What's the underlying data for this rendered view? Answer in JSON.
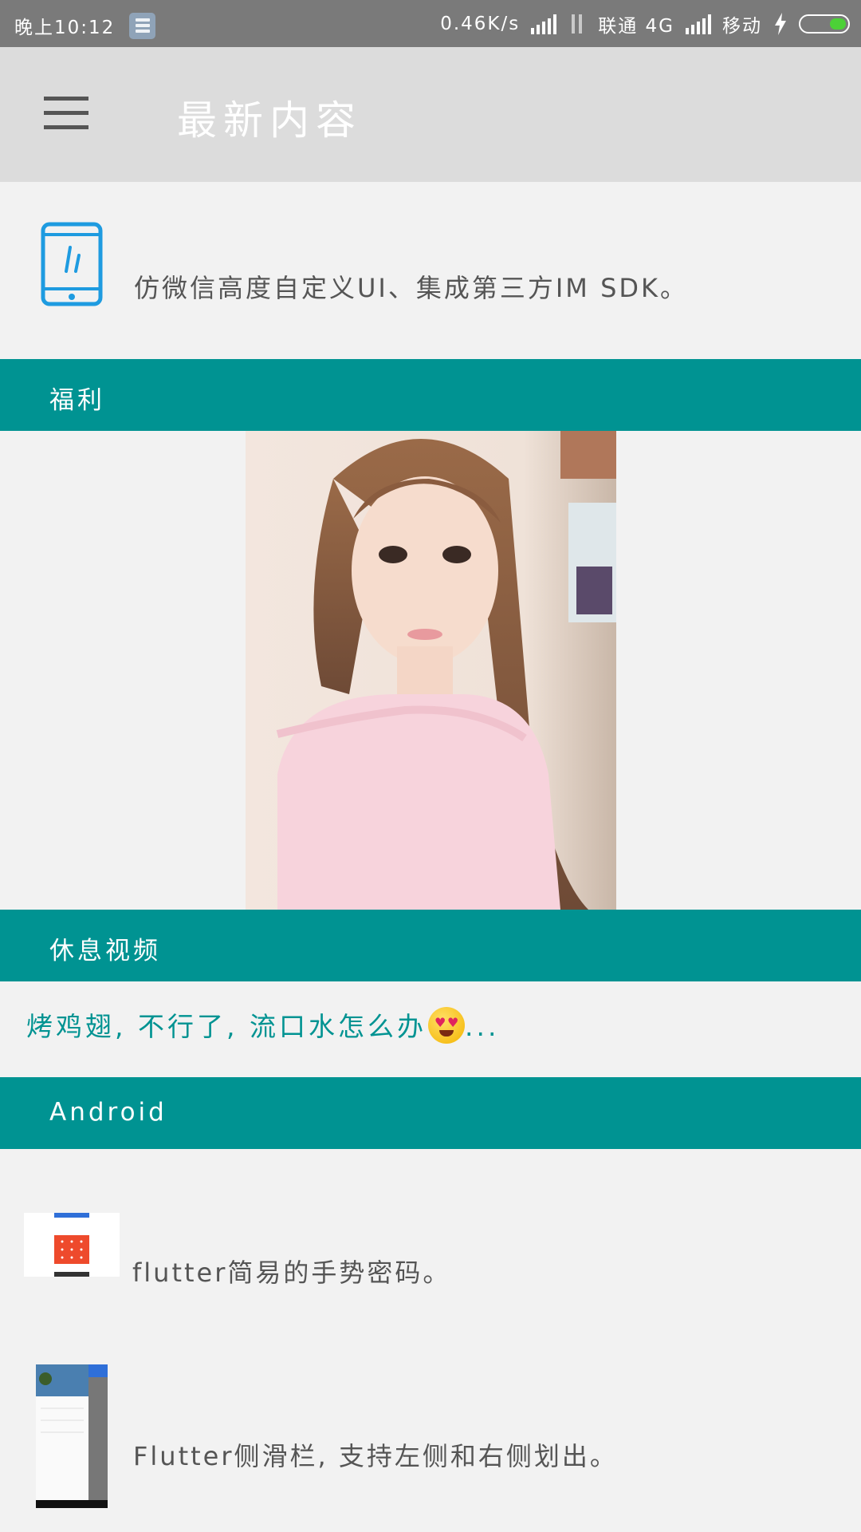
{
  "status_bar": {
    "time": "晚上10:12",
    "speed": "0.46K/s",
    "carrier1": "联通 4G",
    "carrier2": "移动",
    "icons": [
      "notification-doc-icon",
      "signal-icon",
      "data-arrows-icon",
      "signal-icon",
      "charging-icon",
      "battery-icon"
    ],
    "battery_color": "#4cd137"
  },
  "toolbar": {
    "title": "最新内容",
    "menu_icon": "hamburger-menu-icon",
    "background": "#dcdcdc"
  },
  "top_item": {
    "icon": "phone-icon",
    "text": "仿微信高度自定义UI、集成第三方IM SDK。"
  },
  "sections": {
    "fuli": "福利",
    "video": "休息视频",
    "android": "Android",
    "color": "#009392"
  },
  "video_item": {
    "text": "烤鸡翅, 不行了, 流口水怎么办",
    "suffix": "..."
  },
  "android_items": [
    {
      "text": "flutter简易的手势密码。"
    },
    {
      "text": "Flutter侧滑栏, 支持左侧和右侧划出。"
    }
  ]
}
